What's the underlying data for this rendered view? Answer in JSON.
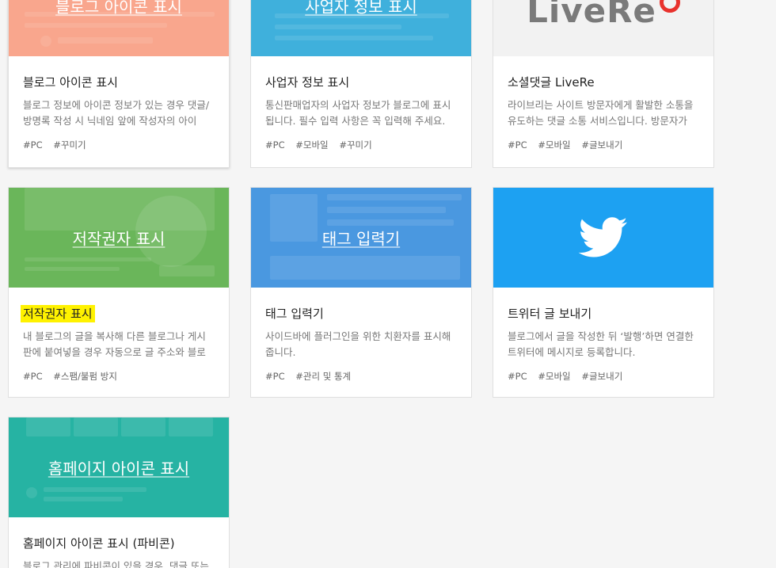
{
  "cards": [
    {
      "thumb_title": "블로그 아이콘 표시",
      "title": "블로그 아이콘 표시",
      "desc": "블로그 정보에 아이콘 정보가 있는 경우 댓글/방명록 작성 시 닉네임 앞에 작성자의 아이콘…",
      "tags": [
        "#PC",
        "#꾸미기"
      ],
      "thumb_color": "#f9a68d"
    },
    {
      "thumb_title": "사업자 정보 표시",
      "title": "사업자 정보 표시",
      "desc": "통신판매업자의 사업자 정보가 블로그에 표시됩니다. 필수 입력 사항은 꼭 입력해 주세요.",
      "tags": [
        "#PC",
        "#모바일",
        "#꾸미기"
      ],
      "thumb_color": "#3fb0dc"
    },
    {
      "thumb_logo": "LiveRe",
      "title": "소셜댓글 LiveRe",
      "desc": "라이브리는 사이트 방문자에게 활발한 소통을 유도하는 댓글 소통 서비스입니다. 방문자가 …",
      "tags": [
        "#PC",
        "#모바일",
        "#글보내기"
      ],
      "thumb_color": "#f2f2f2"
    },
    {
      "thumb_title": "저작권자 표시",
      "title": "저작권자 표시",
      "desc": "내 블로그의 글을 복사해 다른 블로그나 게시판에 붙여넣을 경우 자동으로 글 주소와 블로그…",
      "tags": [
        "#PC",
        "#스팸/불펌 방지"
      ],
      "thumb_color": "#6ab65a"
    },
    {
      "thumb_title": "태그 입력기",
      "title": "태그 입력기",
      "desc": "사이드바에 플러그인을 위한 치환자를 표시해줍니다.",
      "tags": [
        "#PC",
        "#관리 및 통계"
      ],
      "thumb_color": "#4a98e0"
    },
    {
      "title": "트위터 글 보내기",
      "desc": "블로그에서 글을 작성한 뒤 ‘발행’하면 연결한 트위터에 메시지로 등록합니다.",
      "tags": [
        "#PC",
        "#모바일",
        "#글보내기"
      ],
      "thumb_color": "#1da1f2"
    },
    {
      "thumb_title": "홈페이지 아이콘 표시",
      "title": "홈페이지 아이콘 표시 (파비콘)",
      "desc": "블로그 관리에 파비콘이 있을 경우, 댓글 또는",
      "tags": [],
      "thumb_color": "#26b3a3"
    }
  ],
  "colors": {
    "highlight": "#fff200",
    "livere_red": "#e8322d"
  }
}
